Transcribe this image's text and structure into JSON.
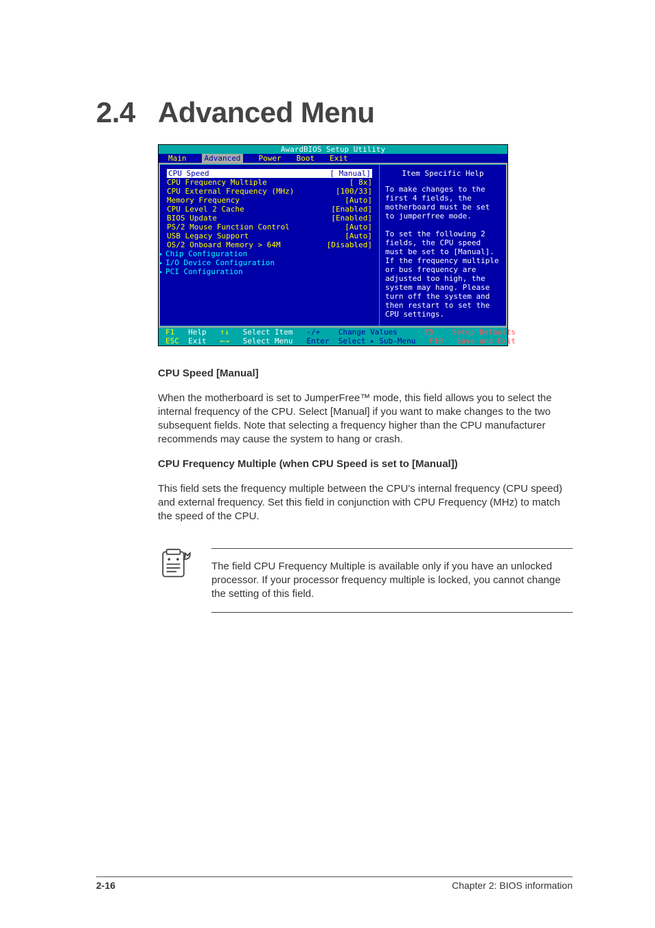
{
  "section": {
    "number": "2.4",
    "title": "Advanced Menu"
  },
  "bios": {
    "header": "AwardBIOS Setup Utility",
    "tabs": {
      "main": "Main",
      "advanced": "Advanced",
      "power": "Power",
      "boot": "Boot",
      "exit": "Exit"
    },
    "settings": [
      {
        "label": "CPU Speed",
        "value": "[ Manual]",
        "selected": true
      },
      {
        "label": "CPU Frequency Multiple",
        "value": "[ 8x]"
      },
      {
        "label": "CPU External Frequency (MHz)",
        "value": "[100/33]"
      },
      {
        "label": "Memory Frequency",
        "value": "[Auto]"
      },
      {
        "label": "CPU Level 2 Cache",
        "value": "[Enabled]"
      },
      {
        "label": "BIOS Update",
        "value": "[Enabled]"
      },
      {
        "label": "PS/2 Mouse Function Control",
        "value": "[Auto]"
      },
      {
        "label": "USB Legacy Support",
        "value": "[Auto]"
      },
      {
        "label": "OS/2 Onboard Memory > 64M",
        "value": "[Disabled]"
      }
    ],
    "submenus": [
      "Chip Configuration",
      "I/O Device Configuration",
      "PCI Configuration"
    ],
    "help_title": "Item Specific Help",
    "help_body": "To make changes to the first 4 fields, the motherboard must be set to jumperfree mode.\n\nTo set the following 2 fields, the CPU speed must be set to [Manual]. If the frequency multiple or bus frequency are adjusted too high, the system may hang. Please turn off the system and then restart to set the CPU settings.",
    "footer": {
      "f1": "F1",
      "help": "Help",
      "arrows_ud": "↑↓",
      "select_item": "Select Item",
      "plusminus": "-/+",
      "change_values": "Change Values",
      "f5": "F5",
      "setup_defaults": "Setup Defaults",
      "esc": "ESC",
      "exit": "Exit",
      "arrows_lr": "←→",
      "select_menu": "Select Menu",
      "enter": "Enter",
      "select_sub": "Select ▸ Sub-Menu",
      "f10": "F10",
      "save_exit": "Save and Exit"
    }
  },
  "para1": "CPU Speed [Manual]",
  "para1b": "When the motherboard is set to JumperFree™ mode, this field allows you to select the internal frequency of the CPU. Select [Manual] if you want to make changes to the two subsequent fields. Note that selecting a frequency higher than the CPU manufacturer recommends may cause the system to hang or crash.",
  "para2": "CPU Frequency Multiple (when CPU Speed is set to [Manual])",
  "para2b": "This field sets the frequency multiple between the CPU's internal frequency (CPU speed) and external frequency. Set this field in conjunction with CPU Frequency (MHz) to match the speed of the CPU.",
  "note": "The field CPU Frequency Multiple is available only if you have an unlocked processor. If your processor frequency multiple is locked, you cannot change the setting of this field.",
  "footer": {
    "left": "2-16",
    "right": "Chapter 2: BIOS information"
  }
}
